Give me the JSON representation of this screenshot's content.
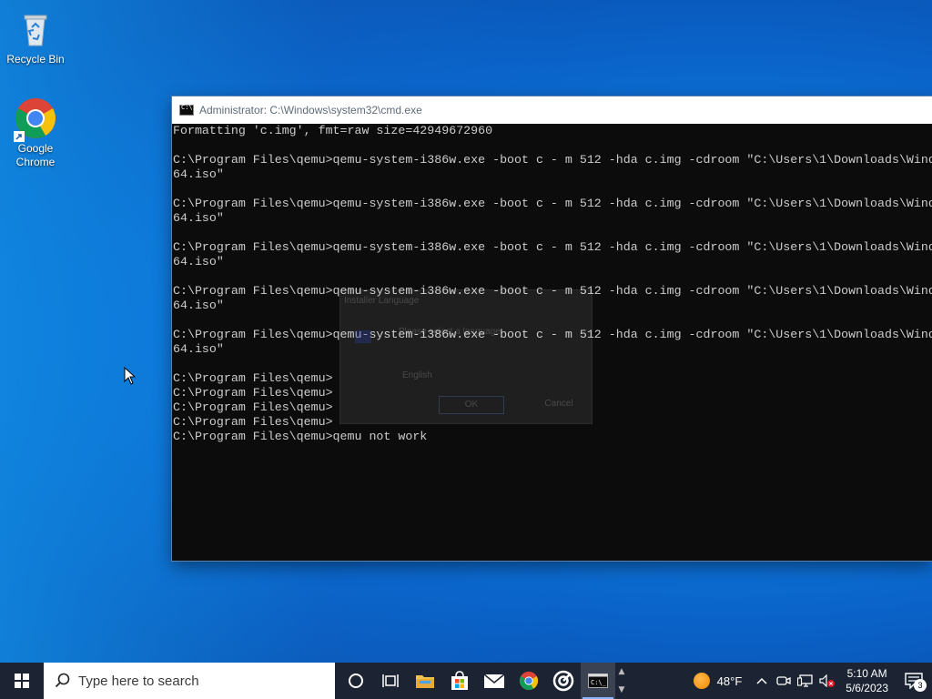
{
  "desktop": {
    "icons": [
      {
        "label": "Recycle Bin",
        "icon": "recycle-bin-icon"
      },
      {
        "label": "Google Chrome",
        "icon": "chrome-icon"
      }
    ]
  },
  "cmd_window": {
    "title": "Administrator: C:\\Windows\\system32\\cmd.exe",
    "lines": [
      "Formatting 'c.img', fmt=raw size=42949672960",
      "",
      "C:\\Program Files\\qemu>qemu-system-i386w.exe -boot c - m 512 -hda c.img -cdroom \"C:\\Users\\1\\Downloads\\Wind",
      "64.iso\"",
      "",
      "C:\\Program Files\\qemu>qemu-system-i386w.exe -boot c - m 512 -hda c.img -cdroom \"C:\\Users\\1\\Downloads\\Wind",
      "64.iso\"",
      "",
      "C:\\Program Files\\qemu>qemu-system-i386w.exe -boot c - m 512 -hda c.img -cdroom \"C:\\Users\\1\\Downloads\\Wind",
      "64.iso\"",
      "",
      "C:\\Program Files\\qemu>qemu-system-i386w.exe -boot c - m 512 -hda c.img -cdroom \"C:\\Users\\1\\Downloads\\Wind",
      "64.iso\"",
      "",
      "C:\\Program Files\\qemu>qemu-system-i386w.exe -boot c - m 512 -hda c.img -cdroom \"C:\\Users\\1\\Downloads\\Wind",
      "64.iso\"",
      "",
      "C:\\Program Files\\qemu>",
      "C:\\Program Files\\qemu>",
      "C:\\Program Files\\qemu>",
      "C:\\Program Files\\qemu>",
      "C:\\Program Files\\qemu>qemu not work"
    ],
    "ghost_dialog": {
      "title": "Installer Language",
      "prompt": "Please select a language.",
      "language": "English",
      "ok_label": "OK",
      "cancel_label": "Cancel"
    }
  },
  "taskbar": {
    "search_placeholder": "Type here to search",
    "apps": [
      "task-view",
      "file-explorer",
      "microsoft-store",
      "mail",
      "chrome",
      "media-app",
      "command-prompt"
    ],
    "weather": {
      "temperature": "48°F"
    },
    "clock": {
      "time": "5:10 AM",
      "date": "5/6/2023"
    },
    "notification_count": "3"
  },
  "colors": {
    "taskbar_bg": "#1c2433",
    "console_bg": "#0c0c0c",
    "console_text": "#cccccc"
  }
}
